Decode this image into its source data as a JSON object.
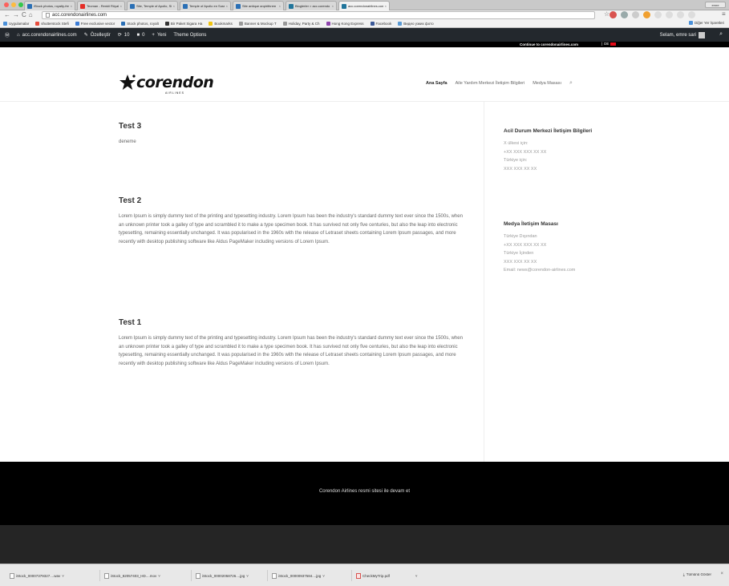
{
  "browser": {
    "tabs": [
      {
        "label": "iStock photos, royalty-fre",
        "color": "#2a6fb5"
      },
      {
        "label": "Teoman - Renkli Rüyalar",
        "color": "#e52d27"
      },
      {
        "label": "Site, Temple of Apollo, Si",
        "color": "#2a6fb5"
      },
      {
        "label": "Temple of Apollo en Suss",
        "color": "#2a6fb5"
      },
      {
        "label": "Site antique anpirithrem",
        "color": "#2a6fb5"
      },
      {
        "label": "Bloglerler > acc.corendo",
        "color": "#21759b"
      },
      {
        "label": "acc.corendonairlines.com",
        "color": "#21759b",
        "active": true
      }
    ],
    "profile": "emre",
    "url": "acc.corendonairlines.com",
    "bookmarks": [
      {
        "label": "Uygulamalar",
        "color": "#4a90d9"
      },
      {
        "label": "shutterstock Stefi",
        "color": "#e74c3c"
      },
      {
        "label": "Free exclusive vector",
        "color": "#3a7bd5"
      },
      {
        "label": "Stock photos, royalt",
        "color": "#2a6fb5"
      },
      {
        "label": "Bir Paket Sigara Ha",
        "color": "#333333"
      },
      {
        "label": "Bookmarks",
        "color": "#f1c40f"
      },
      {
        "label": "Banner & Mockup T",
        "color": "#999999"
      },
      {
        "label": "Holiday, Party & Ch",
        "color": "#999999"
      },
      {
        "label": "Hong Kong Express",
        "color": "#8e44ad"
      },
      {
        "label": "Facebook",
        "color": "#3b5998"
      },
      {
        "label": "Видео узких фото",
        "color": "#5b9bd5"
      }
    ],
    "bookmarks_other": "Diğer Yer İşaretleri"
  },
  "admin_bar": {
    "site": "acc.corendonairlines.com",
    "customize": "Özelleştir",
    "updates": "10",
    "comments": "0",
    "new": "Yeni",
    "theme_options": "Theme Options",
    "greeting": "Selam, emre sari"
  },
  "topbar": {
    "continue": "Continue to corendonairlines.com",
    "lang": "DE"
  },
  "header": {
    "logo": "corendon",
    "logo_sub": "AIRLINES",
    "menu": [
      "Ana Sayfa",
      "Aile Yardım Merkezi İletişim Bilgileri",
      "Medya Masası"
    ]
  },
  "posts": [
    {
      "title": "Test 3",
      "body": "deneme"
    },
    {
      "title": "Test 2",
      "body": "Lorem Ipsum is simply dummy text of the printing and typesetting industry. Lorem Ipsum has been the industry's standard dummy text ever since the 1500s, when an unknown printer took a galley of type and scrambled it to make a type specimen book. It has survived not only five centuries, but also the leap into electronic typesetting, remaining essentially unchanged. It was popularised in the 1960s with the release of Letraset sheets containing Lorem Ipsum passages, and more recently with desktop publishing software like Aldus PageMaker including versions of Lorem Ipsum."
    },
    {
      "title": "Test 1",
      "body": "Lorem Ipsum is simply dummy text of the printing and typesetting industry. Lorem Ipsum has been the industry's standard dummy text ever since the 1500s, when an unknown printer took a galley of type and scrambled it to make a type specimen book. It has survived not only five centuries, but also the leap into electronic typesetting, remaining essentially unchanged. It was popularised in the 1960s with the release of Letraset sheets containing Lorem Ipsum passages, and more recently with desktop publishing software like Aldus PageMaker including versions of Lorem Ipsum."
    }
  ],
  "sidebar": {
    "emergency": {
      "title": "Acil Durum Merkezi İletişim Bilgileri",
      "lines": [
        "X ülkesi için:",
        "+XX XXX XXX XX XX",
        "Türkiye için:",
        "XXX XXX XX XX"
      ]
    },
    "media": {
      "title": "Medya İletişim Masası",
      "lines": [
        "Türkiye Dışından",
        "+XX XXX XXX XX XX",
        "Türkiye İçinden",
        "XXX XXX XX XX",
        "Email: news@corendon-airlines.com"
      ]
    }
  },
  "footer": {
    "text": "Corendon Airlines resmi sitesi ile devam et"
  },
  "downloads": {
    "items": [
      "iStock_000073793​27....wav",
      "iStock_82057403_HD....mov",
      "iStock_000020587​26....jpg",
      "iStock_000009375​84....jpg",
      "CheckMyTrip.pdf"
    ],
    "show_all": "Tümünü Göster"
  },
  "colors": {
    "admin_bar": "#23282d",
    "footer_top": "#000000",
    "footer_bottom": "#252525",
    "flag": "#e30a17"
  }
}
